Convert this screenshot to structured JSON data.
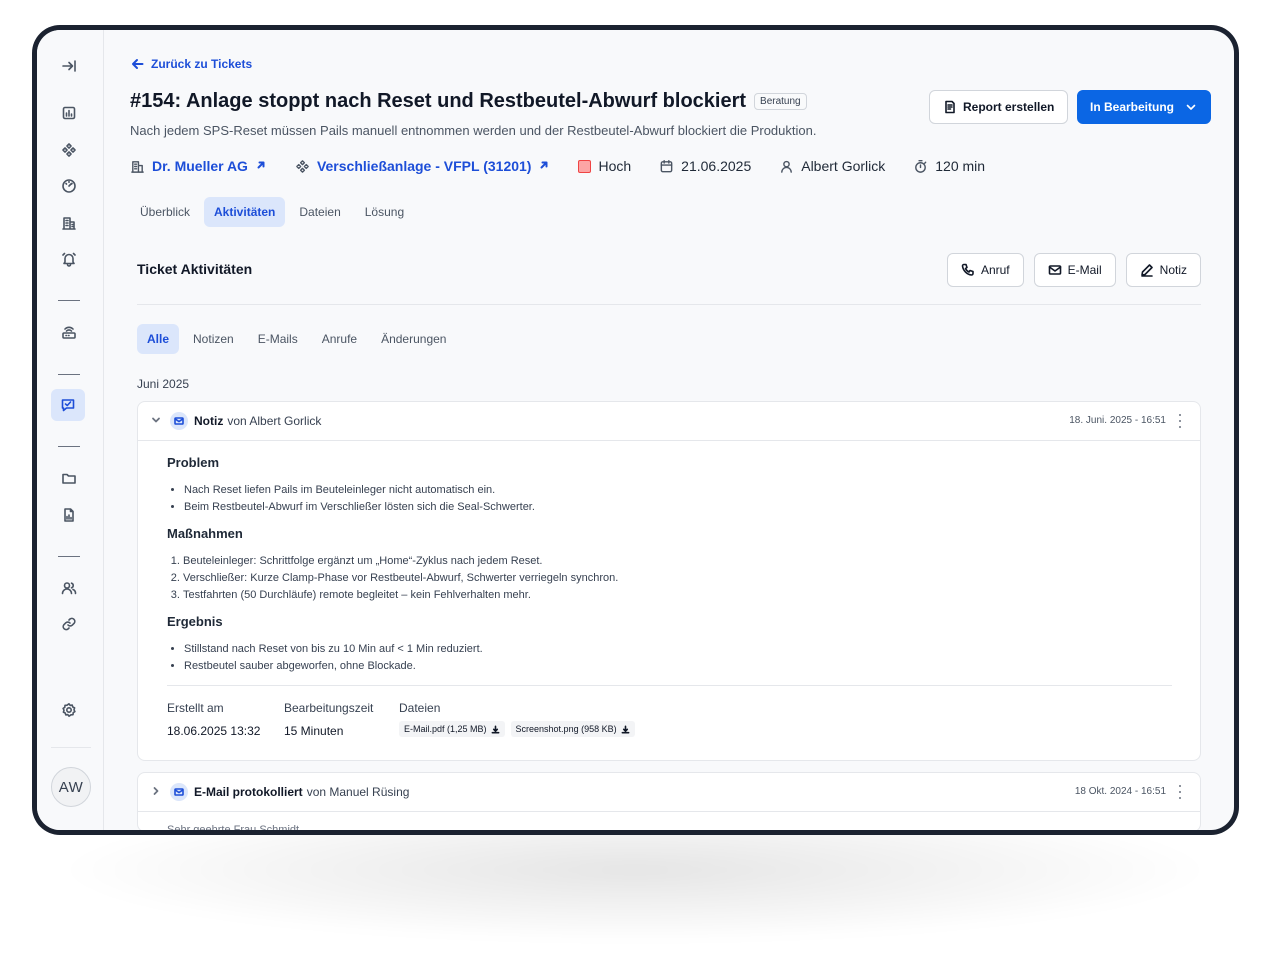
{
  "user": {
    "initials": "AW"
  },
  "back": {
    "label": "Zurück zu Tickets"
  },
  "ticket": {
    "title": "#154: Anlage stoppt nach Reset und Restbeutel-Abwurf blockiert",
    "badge": "Beratung",
    "subtitle": "Nach jedem SPS-Reset müssen Pails manuell entnommen werden und der Restbeutel-Abwurf blockiert die Produktion.",
    "customer": "Dr. Mueller AG",
    "machine": "Verschließanlage - VFPL (31201)",
    "priority": "Hoch",
    "priority_color": "#fca5a5",
    "date": "21.06.2025",
    "assignee": "Albert Gorlick",
    "duration": "120 min"
  },
  "header_buttons": {
    "report": "Report erstellen",
    "status": "In Bearbeitung"
  },
  "tabs": [
    {
      "label": "Überblick"
    },
    {
      "label": "Aktivitäten"
    },
    {
      "label": "Dateien"
    },
    {
      "label": "Lösung"
    }
  ],
  "activities": {
    "title": "Ticket Aktivitäten",
    "actions": {
      "call": "Anruf",
      "email": "E-Mail",
      "note": "Notiz"
    },
    "filters": [
      "Alle",
      "Notizen",
      "E-Mails",
      "Anrufe",
      "Änderungen"
    ],
    "month": "Juni 2025"
  },
  "note_card": {
    "type": "Notiz",
    "by": "von Albert Gorlick",
    "date": "18. Juni. 2025 - 16:51",
    "problem_heading": "Problem",
    "problem_items": [
      "Nach Reset liefen Pails im Beuteleinleger nicht automatisch ein.",
      "Beim Restbeutel-Abwurf im Verschließer lösten sich die Seal-Schwerter."
    ],
    "measures_heading": "Maßnahmen",
    "measures_items": [
      "Beuteleinleger: Schrittfolge ergänzt um „Home“-Zyklus nach jedem Reset.",
      "Verschließer: Kurze Clamp-Phase vor Restbeutel-Abwurf, Schwerter verriegeln synchron.",
      "Testfahrten (50 Durchläufe) remote begleitet – kein Fehlverhalten mehr."
    ],
    "result_heading": "Ergebnis",
    "result_items": [
      "Stillstand nach Reset von bis zu 10 Min auf < 1 Min reduziert.",
      "Restbeutel sauber abgeworfen, ohne Blockade."
    ],
    "created_label": "Erstellt am",
    "created_value": "18.06.2025 13:32",
    "worktime_label": "Bearbeitungszeit",
    "worktime_value": "15 Minuten",
    "files_label": "Dateien",
    "files": [
      "E-Mail.pdf (1,25 MB)",
      "Screenshot.png (958 KB)"
    ]
  },
  "email_card": {
    "type": "E-Mail protokolliert",
    "by": "von Manuel Rüsing",
    "date": "18 Okt. 2024 - 16:51",
    "preview": "Sehr geehrte Frau Schmidt"
  },
  "colors": {
    "accent": "#0b66e4",
    "active_bg": "#dbe6fb",
    "frame": "#1b2230"
  }
}
